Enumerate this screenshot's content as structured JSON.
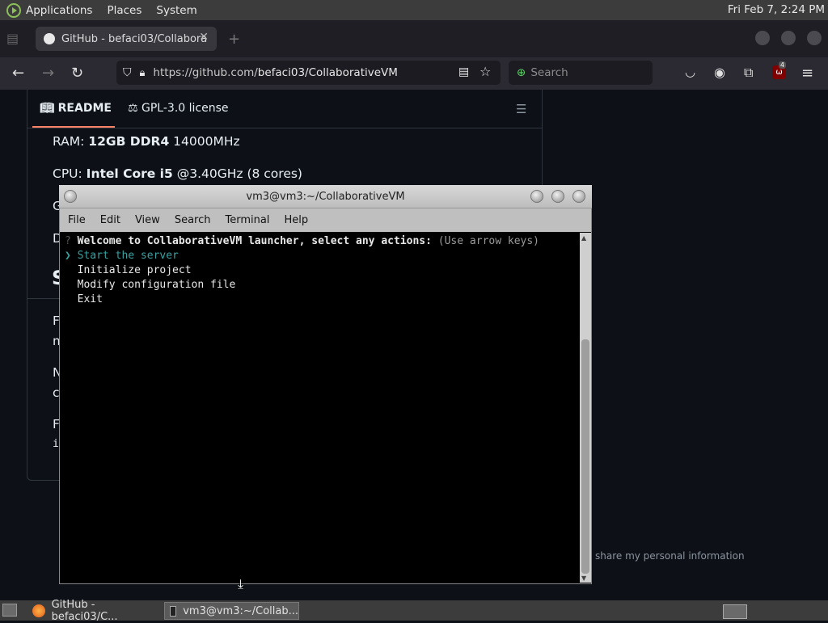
{
  "top_panel": {
    "menus": [
      "Applications",
      "Places",
      "System"
    ],
    "clock": "Fri Feb  7,  2:24 PM"
  },
  "browser": {
    "tab_title": "GitHub - befaci03/Collabora",
    "url_host": "https://github.com/",
    "url_path": "befaci03/CollaborativeVM",
    "search_placeholder": "Search",
    "extension_badge": "4"
  },
  "readme": {
    "tabs": [
      "README",
      "GPL-3.0 license"
    ],
    "ram_label": "RAM: ",
    "ram_bold": "12GB DDR4",
    "ram_rest": " 14000MHz",
    "cpu_label": "CPU: ",
    "cpu_bold": "Intel Core i5",
    "cpu_rest": " @3.40GHz (8 cores)",
    "peek_letters": [
      "G",
      "D",
      "S",
      "F",
      "m",
      "N",
      "c",
      "F",
      "i"
    ],
    "privacy_text": "share my personal information"
  },
  "terminal": {
    "title": "vm3@vm3:~/CollaborativeVM",
    "menu": [
      "File",
      "Edit",
      "View",
      "Search",
      "Terminal",
      "Help"
    ],
    "prompt_mark": "?",
    "prompt_text": "Welcome to CollaborativeVM launcher, select any actions:",
    "prompt_hint": "(Use arrow keys)",
    "cursor": "❯",
    "options": [
      "Start the server",
      "Initialize project",
      "Modify configuration file",
      "Exit"
    ],
    "selected_color": "#3aa0a0"
  },
  "taskbar": {
    "items": [
      "GitHub - befaci03/C...",
      "vm3@vm3:~/Collab..."
    ]
  }
}
